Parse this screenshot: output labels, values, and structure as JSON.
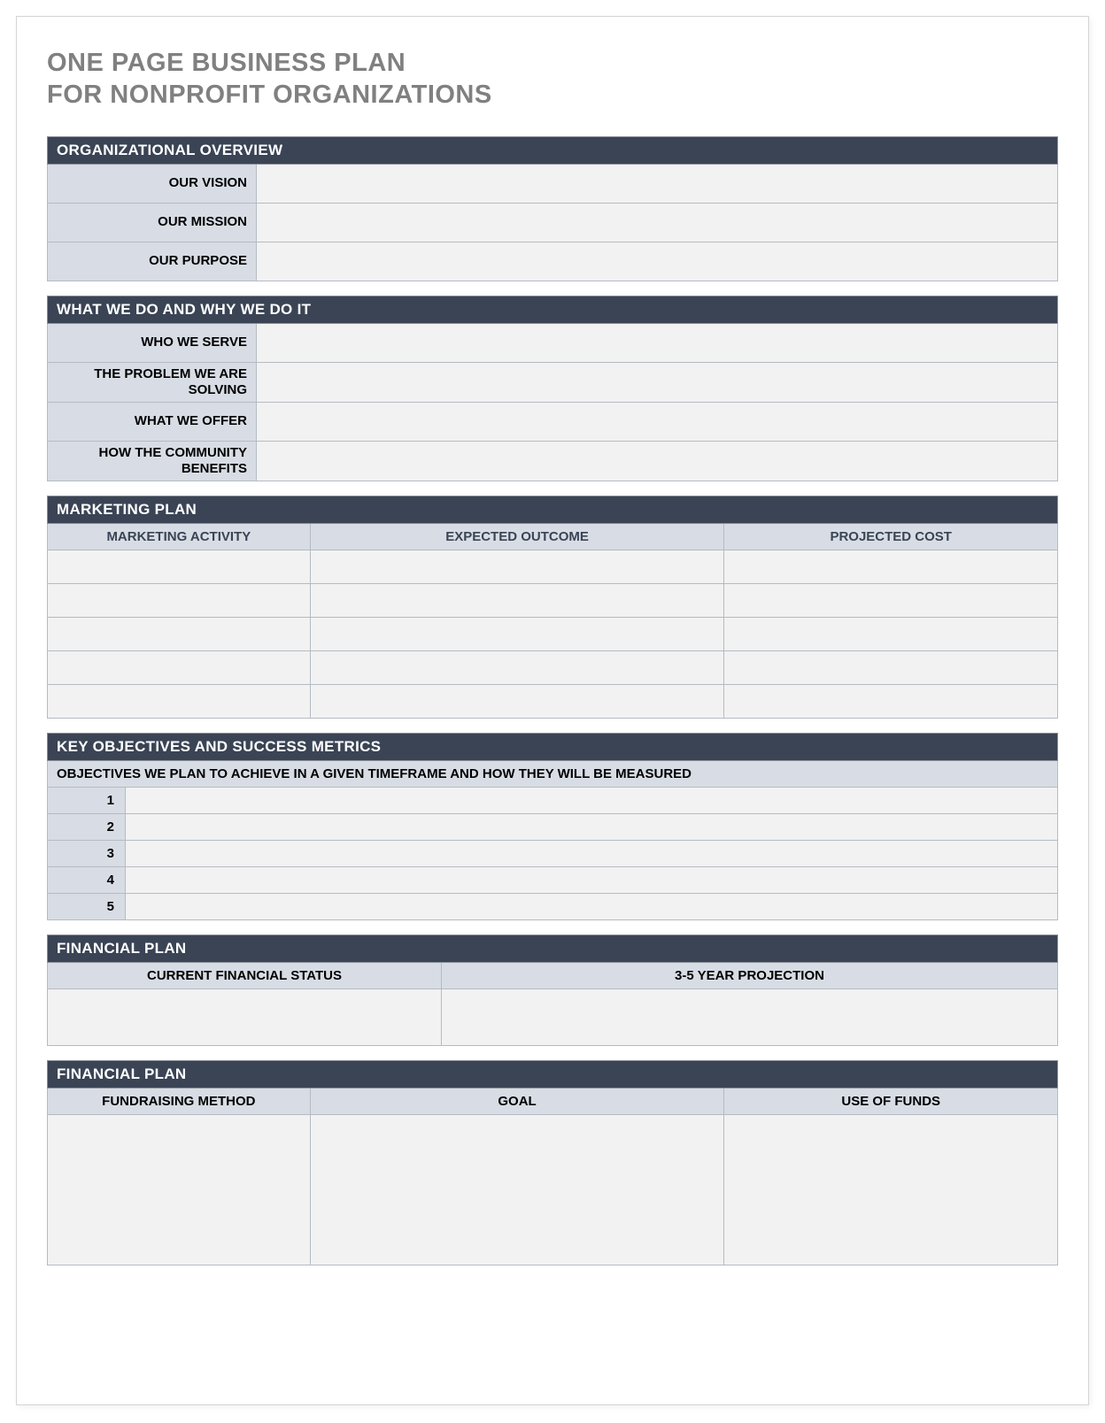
{
  "title_line1": "ONE PAGE BUSINESS PLAN",
  "title_line2": "FOR NONPROFIT ORGANIZATIONS",
  "overview": {
    "header": "ORGANIZATIONAL OVERVIEW",
    "rows": [
      {
        "label": "OUR VISION",
        "value": ""
      },
      {
        "label": "OUR MISSION",
        "value": ""
      },
      {
        "label": "OUR PURPOSE",
        "value": ""
      }
    ]
  },
  "what_we_do": {
    "header": "WHAT WE DO AND WHY WE DO IT",
    "rows": [
      {
        "label": "WHO WE SERVE",
        "value": ""
      },
      {
        "label": "THE PROBLEM WE ARE SOLVING",
        "value": ""
      },
      {
        "label": "WHAT WE OFFER",
        "value": ""
      },
      {
        "label": "HOW THE COMMUNITY BENEFITS",
        "value": ""
      }
    ]
  },
  "marketing": {
    "header": "MARKETING PLAN",
    "columns": [
      "MARKETING ACTIVITY",
      "EXPECTED OUTCOME",
      "PROJECTED COST"
    ],
    "rows": [
      {
        "activity": "",
        "outcome": "",
        "cost": ""
      },
      {
        "activity": "",
        "outcome": "",
        "cost": ""
      },
      {
        "activity": "",
        "outcome": "",
        "cost": ""
      },
      {
        "activity": "",
        "outcome": "",
        "cost": ""
      },
      {
        "activity": "",
        "outcome": "",
        "cost": ""
      }
    ]
  },
  "objectives": {
    "header": "KEY OBJECTIVES AND SUCCESS METRICS",
    "subheader": "OBJECTIVES WE PLAN TO ACHIEVE IN A GIVEN TIMEFRAME AND HOW THEY WILL BE MEASURED",
    "rows": [
      {
        "num": "1",
        "value": ""
      },
      {
        "num": "2",
        "value": ""
      },
      {
        "num": "3",
        "value": ""
      },
      {
        "num": "4",
        "value": ""
      },
      {
        "num": "5",
        "value": ""
      }
    ]
  },
  "financial_status": {
    "header": "FINANCIAL PLAN",
    "columns": [
      "CURRENT FINANCIAL STATUS",
      "3-5 YEAR PROJECTION"
    ],
    "current": "",
    "projection": ""
  },
  "fundraising": {
    "header": "FINANCIAL PLAN",
    "columns": [
      "FUNDRAISING METHOD",
      "GOAL",
      "USE OF FUNDS"
    ],
    "method": "",
    "goal": "",
    "use": ""
  }
}
